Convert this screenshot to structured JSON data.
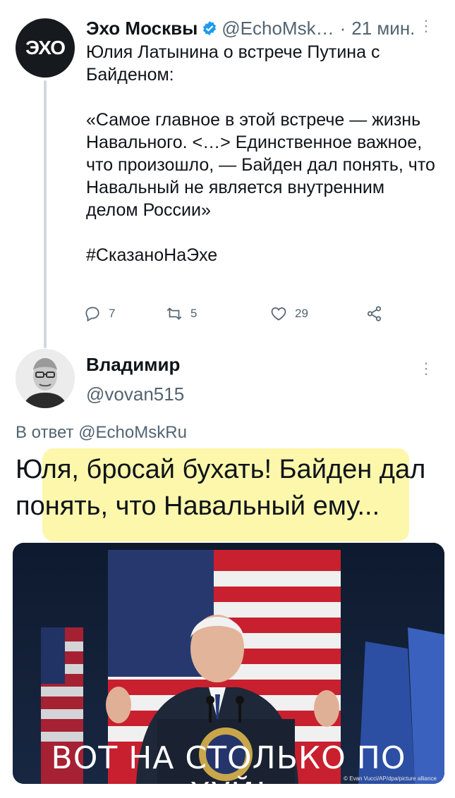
{
  "tweet": {
    "author_name": "Эхо Москвы",
    "author_handle": "@EchoMsk…",
    "separator": "·",
    "time": "21 мин.",
    "avatar_text": "ЭХО",
    "text_intro": "Юлия Латынина о встрече Путина с Байденом:",
    "text_quote": "«Самое главное в этой встрече — жизнь Навального. <…> Единственное важное, что произошло, — Байден дал понять, что Навальный не является внутренним делом России»",
    "hashtag": "#СказаноНаЭхе",
    "replies": "7",
    "retweets": "5",
    "likes": "29",
    "more": "⋮"
  },
  "reply": {
    "author_name": "Владимир",
    "author_handle": "@vovan515",
    "replying_prefix": "В ответ",
    "replying_to": "@EchoMskRu",
    "text": "Юля, бросай бухать! Байден дал понять, что Навальный ему...",
    "more": "⋮"
  },
  "photo": {
    "caption": "ВОТ НА СТОЛЬКО ПО ХУЙ!",
    "credit": "© Evan Vucci/AP/dpa/picture alliance"
  },
  "colors": {
    "accent": "#1d9bf0",
    "secondary_text": "#536471",
    "highlight": "#fcf7a6"
  }
}
